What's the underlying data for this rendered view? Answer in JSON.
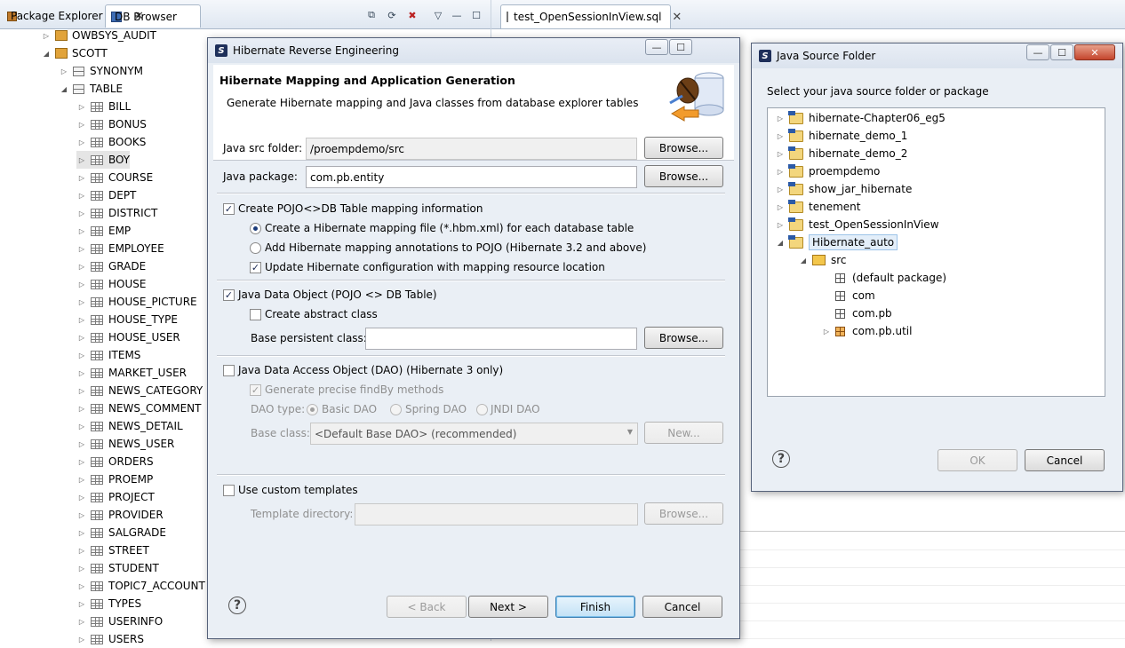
{
  "left_view": {
    "tabs": [
      {
        "label": "Package Explorer",
        "icon": "package-explorer-icon"
      },
      {
        "label": "DB Browser",
        "icon": "db-browser-icon",
        "close": "✕"
      }
    ],
    "tree": {
      "owbsys": "OWBSYS_AUDIT",
      "scott": "SCOTT",
      "synonym": "SYNONYM",
      "table": "TABLE",
      "tables": [
        "BILL",
        "BONUS",
        "BOOKS",
        "BOY",
        "COURSE",
        "DEPT",
        "DISTRICT",
        "EMP",
        "EMPLOYEE",
        "GRADE",
        "HOUSE",
        "HOUSE_PICTURE",
        "HOUSE_TYPE",
        "HOUSE_USER",
        "ITEMS",
        "MARKET_USER",
        "NEWS_CATEGORY",
        "NEWS_COMMENT",
        "NEWS_DETAIL",
        "NEWS_USER",
        "ORDERS",
        "PROEMP",
        "PROJECT",
        "PROVIDER",
        "SALGRADE",
        "STREET",
        "STUDENT",
        "TOPIC7_ACCOUNT",
        "TYPES",
        "USERINFO",
        "USERS"
      ],
      "selected": "BOY"
    }
  },
  "editor": {
    "tab_label": "test_OpenSessionInView.sql",
    "tab_close": "✕"
  },
  "reverse_dialog": {
    "title": "Hibernate Reverse Engineering",
    "header_title": "Hibernate Mapping and Application Generation",
    "header_desc": "Generate Hibernate mapping and Java classes from database explorer tables",
    "java_src_label": "Java src folder:",
    "java_src_value": "/proempdemo/src",
    "java_pkg_label": "Java package:",
    "java_pkg_value": "com.pb.entity",
    "browse": "Browse...",
    "create_pojo": "Create POJO<>DB Table mapping information",
    "opt_hbm": "Create a Hibernate mapping file (*.hbm.xml) for each database table",
    "opt_annot": "Add Hibernate mapping annotations to POJO (Hibernate 3.2 and above)",
    "opt_update": "Update Hibernate configuration with mapping resource location",
    "java_data_object": "Java Data Object (POJO <> DB Table)",
    "create_abstract": "Create abstract class",
    "base_persistent": "Base persistent class:",
    "java_dao": "Java Data Access Object (DAO) (Hibernate 3 only)",
    "gen_findby": "Generate precise findBy methods",
    "dao_type": "DAO type:",
    "dao_basic": "Basic DAO",
    "dao_spring": "Spring DAO",
    "dao_jndi": "JNDI DAO",
    "base_class": "Base class:",
    "base_class_value": "<Default Base DAO> (recommended)",
    "new_btn": "New...",
    "custom_templates": "Use custom templates",
    "template_dir": "Template directory:",
    "back": "< Back",
    "next": "Next >",
    "finish": "Finish",
    "cancel": "Cancel"
  },
  "source_dialog": {
    "title": "Java Source Folder",
    "prompt": "Select your java source folder or package",
    "projects": [
      "hibernate-Chapter06_eg5",
      "hibernate_demo_1",
      "hibernate_demo_2",
      "proempdemo",
      "show_jar_hibernate",
      "tenement",
      "test_OpenSessionInView"
    ],
    "selected_project": "Hibernate_auto",
    "src": "src",
    "packages": [
      "(default package)",
      "com",
      "com.pb",
      "com.pb.util"
    ],
    "ok": "OK",
    "cancel": "Cancel"
  }
}
